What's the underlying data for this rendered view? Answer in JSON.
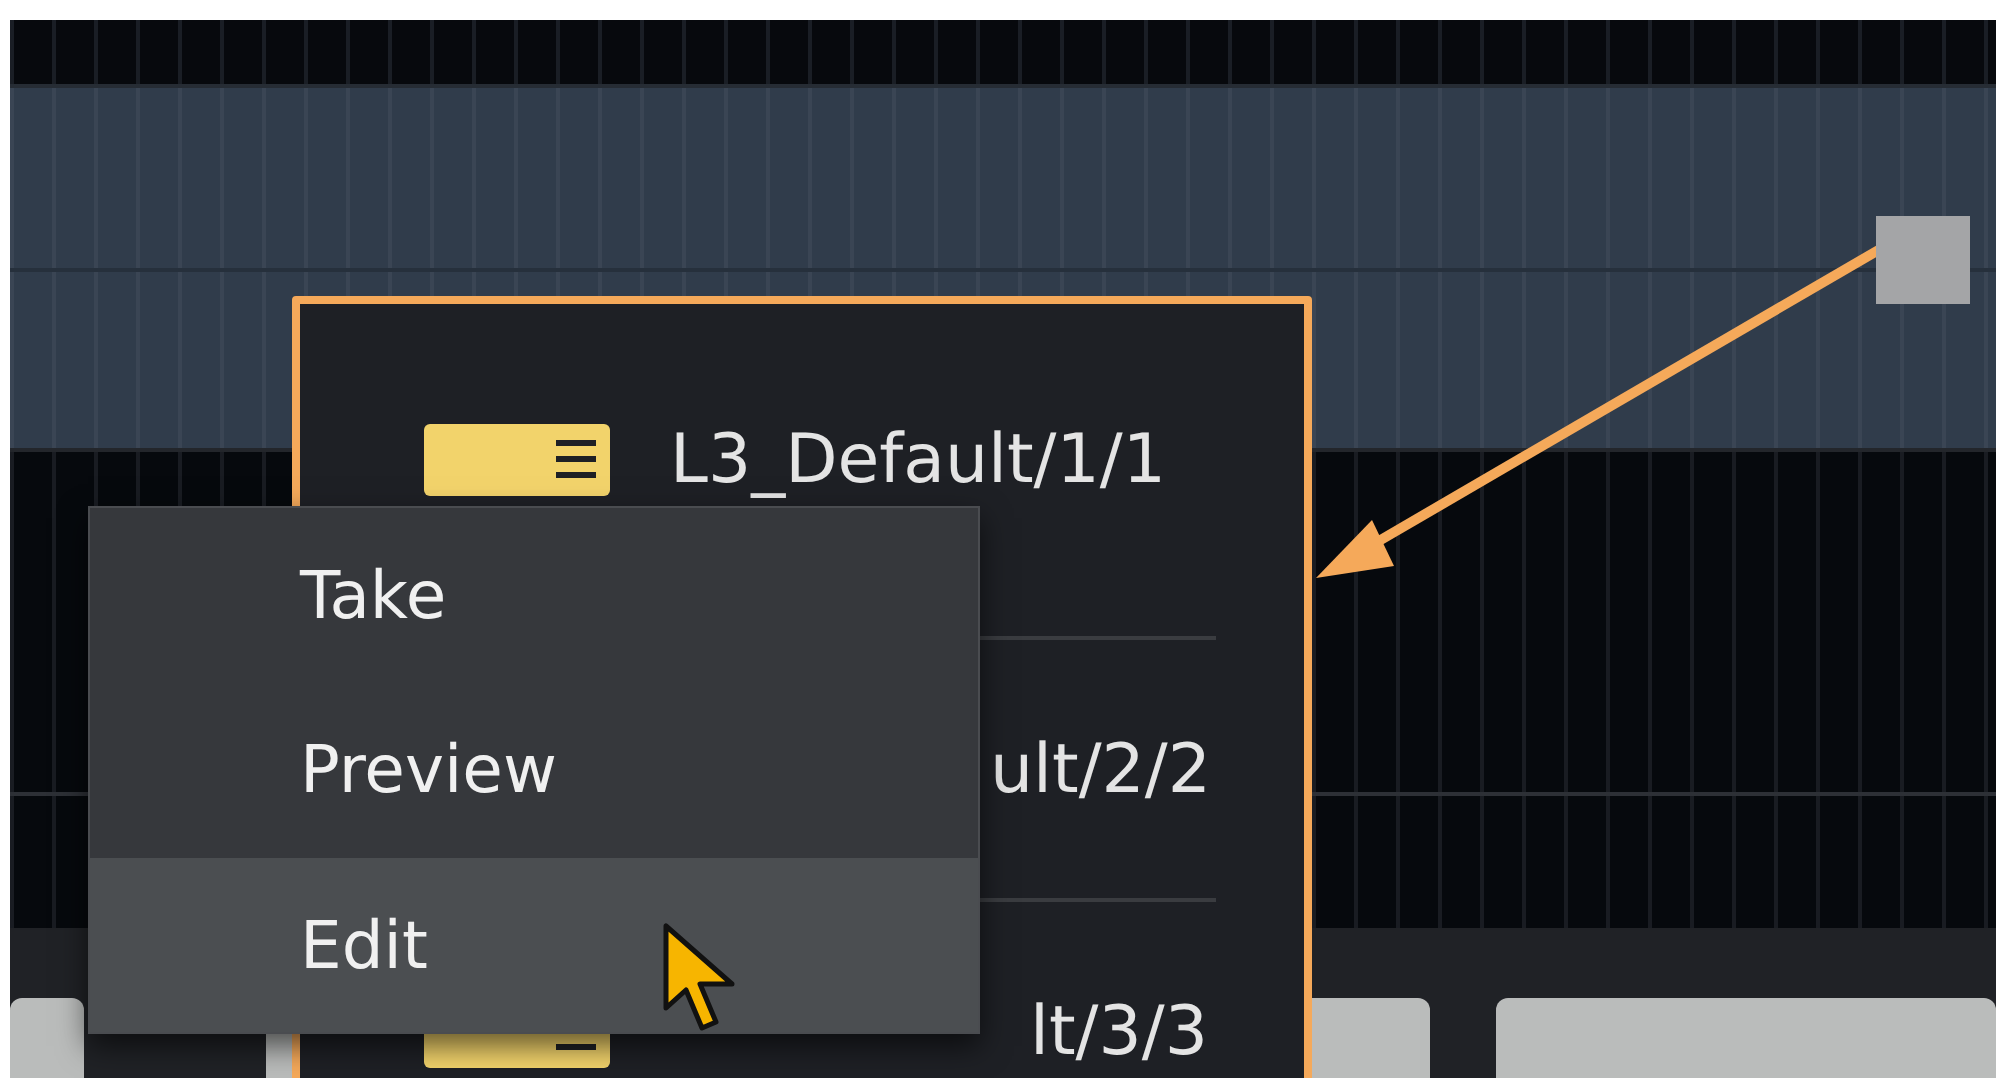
{
  "callout": {
    "rows": [
      {
        "label": "L3_Default/1/1"
      },
      {
        "label": "ult/2/2"
      },
      {
        "label": "lt/3/3"
      }
    ]
  },
  "context_menu": {
    "items": [
      {
        "label": "Take",
        "selected": false
      },
      {
        "label": "Preview",
        "selected": false
      },
      {
        "label": "Edit",
        "selected": true
      }
    ]
  }
}
